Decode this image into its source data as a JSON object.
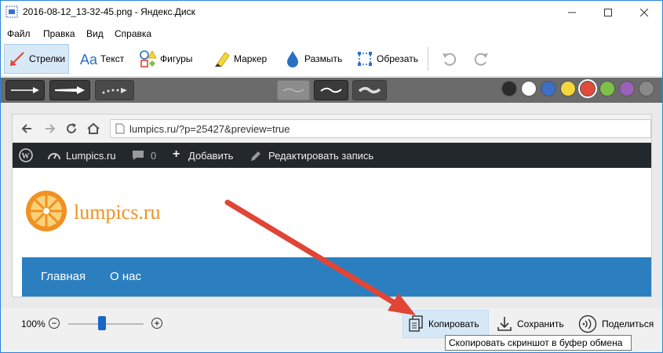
{
  "window": {
    "title": "2016-08-12_13-32-45.png - Яндекс.Диск"
  },
  "menu": {
    "items": [
      "Файл",
      "Правка",
      "Вид",
      "Справка"
    ]
  },
  "tools": {
    "arrows": "Стрелки",
    "text": "Текст",
    "shapes": "Фигуры",
    "marker": "Маркер",
    "blur": "Размыть",
    "crop": "Обрезать"
  },
  "palette": {
    "colors": [
      "#2b2b2b",
      "#ffffff",
      "#3d6fc4",
      "#f5d63d",
      "#e24a3b",
      "#7fc046",
      "#9a62b6",
      "#8a8a8a"
    ],
    "selected_index": 4
  },
  "screenshot": {
    "url": "lumpics.ru/?p=25427&preview=true",
    "wp_bar": {
      "site": "Lumpics.ru",
      "comments": "0",
      "add": "Добавить",
      "edit": "Редактировать запись"
    },
    "site_name": "lumpics.ru",
    "nav": [
      "Главная",
      "О нас"
    ],
    "accent_color": "#2b7fbf",
    "logo_color": "#f19122"
  },
  "annotation": {
    "arrow_color": "#e04535"
  },
  "bottom": {
    "zoom": "100%",
    "zoom_level_fraction": 0.45,
    "copy": "Копировать",
    "save": "Сохранить",
    "share": "Поделиться",
    "tooltip": "Скопировать скриншот в буфер обмена"
  }
}
